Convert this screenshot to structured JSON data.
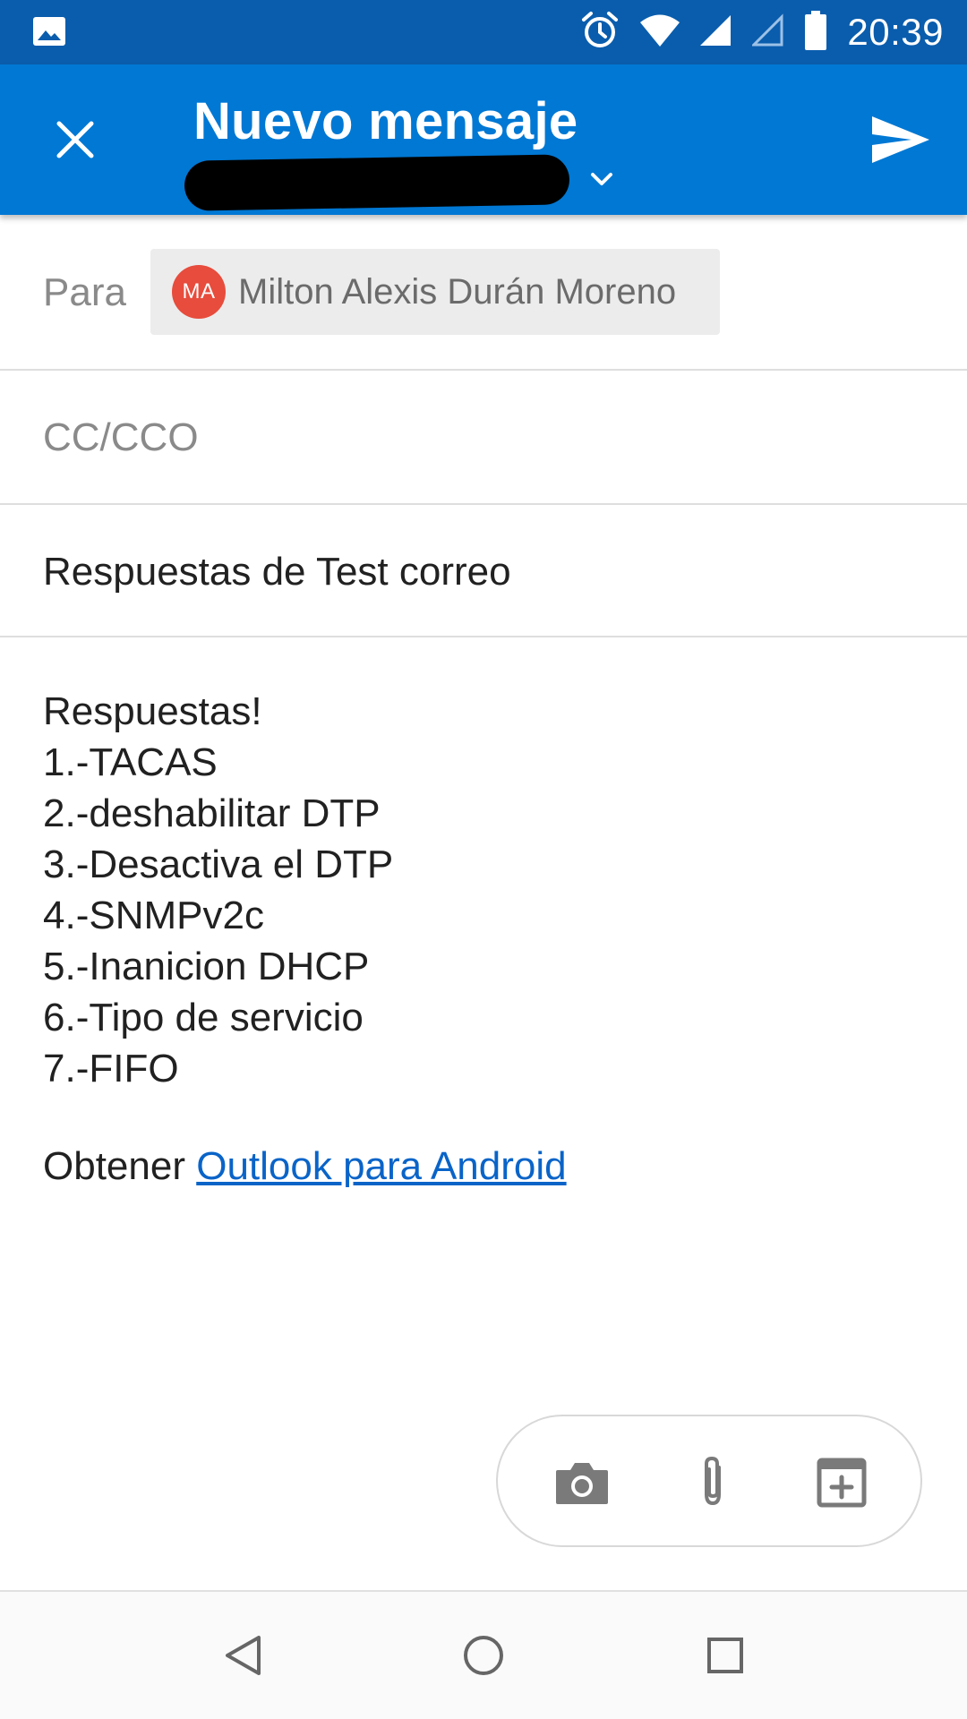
{
  "status_bar": {
    "time": "20:39",
    "icons": [
      "image-notification-icon",
      "alarm-icon",
      "wifi-icon",
      "signal-icon",
      "signal-empty-icon",
      "battery-icon"
    ]
  },
  "app_bar": {
    "title": "Nuevo mensaje",
    "close_icon": "close-icon",
    "send_icon": "send-icon",
    "chevron_icon": "chevron-down-icon",
    "background_color": "#0078d4"
  },
  "compose": {
    "to_label": "Para",
    "recipient": {
      "initials": "MA",
      "name": "Milton Alexis Durán Moreno",
      "avatar_color": "#e74c3c"
    },
    "cc_label": "CC/CCO",
    "subject": "Respuestas de Test correo",
    "body_lines": [
      "Respuestas!",
      "1.-TACAS",
      "2.-deshabilitar DTP",
      "3.-Desactiva el DTP",
      "4.-SNMPv2c",
      "5.-Inanicion DHCP",
      "6.-Tipo de servicio",
      "7.-FIFO"
    ],
    "signature_prefix": "Obtener",
    "signature_link": "Outlook para Android"
  },
  "attachment_toolbar": {
    "icons": [
      "camera-icon",
      "paperclip-icon",
      "calendar-add-icon"
    ]
  },
  "nav_bar": {
    "icons": [
      "back-icon",
      "home-icon",
      "recents-icon"
    ]
  }
}
